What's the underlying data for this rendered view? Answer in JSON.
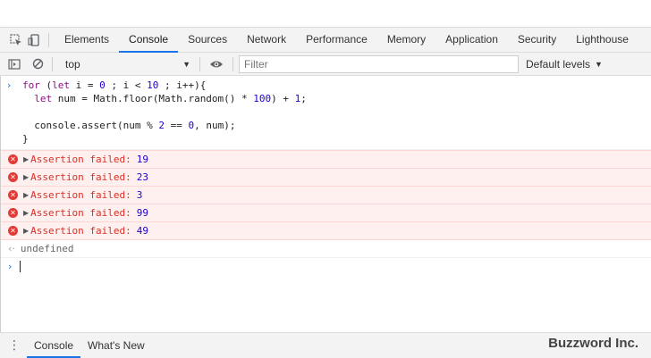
{
  "tabs": [
    "Elements",
    "Console",
    "Sources",
    "Network",
    "Performance",
    "Memory",
    "Application",
    "Security",
    "Lighthouse"
  ],
  "active_tab": "Console",
  "toolbar": {
    "context": "top",
    "filter_placeholder": "Filter",
    "levels_label": "Default levels"
  },
  "console": {
    "code_lines": [
      "for (let i = 0 ; i < 10 ; i++){",
      "  let num = Math.floor(Math.random() * 100) + 1;",
      "",
      "  console.assert(num % 2 == 0, num);",
      "}"
    ],
    "error_label": "Assertion failed:",
    "errors": [
      "19",
      "23",
      "3",
      "99",
      "49"
    ],
    "result": "undefined"
  },
  "drawer": {
    "tabs": [
      "Console",
      "What's New"
    ],
    "active": "Console"
  },
  "watermark": "Buzzword Inc.",
  "colors": {
    "accent": "#1a73e8",
    "error_text": "#d93025",
    "error_bg": "#fff0f0",
    "keyword": "#881280",
    "number": "#1c00cf"
  },
  "icons": [
    "inspect-element-icon",
    "device-toggle-icon",
    "sidebar-toggle-icon",
    "clear-console-icon",
    "eye-icon",
    "dropdown-caret-icon",
    "error-icon",
    "expand-triangle-icon",
    "result-arrow-icon",
    "prompt-chevron-icon",
    "kebab-menu-icon"
  ]
}
